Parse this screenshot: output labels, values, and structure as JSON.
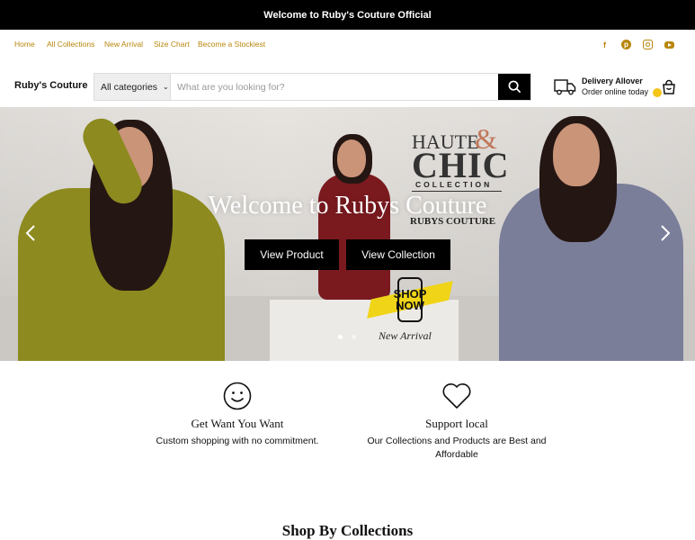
{
  "announcement": "Welcome to Ruby's Couture Official",
  "nav": {
    "items": [
      "Home",
      "All Collections",
      "New Arrival",
      "Size Chart",
      "Become a Stockiest"
    ]
  },
  "social": [
    "facebook-icon",
    "pinterest-icon",
    "instagram-icon",
    "youtube-icon"
  ],
  "header": {
    "brand": "Ruby's Couture",
    "category_select": "All categories",
    "search_placeholder": "What are you looking for?",
    "delivery_title": "Delivery Allover",
    "delivery_subtitle": "Order online today"
  },
  "hero": {
    "title": "Welcome to Rubys Couture",
    "buttons": [
      "View Product",
      "View Collection"
    ],
    "brand_haute": "HAUTE",
    "brand_amp": "&",
    "brand_chic": "CHIC",
    "brand_collection": "COLLECTION",
    "brand_rubys": "RUBYS COUTURE",
    "shop_now": "SHOP NOW",
    "new_arrival": "New Arrival",
    "slide_index": 1,
    "slide_count": 2
  },
  "features": [
    {
      "icon": "smile-icon",
      "title": "Get Want You Want",
      "description": "Custom shopping with no commitment."
    },
    {
      "icon": "heart-icon",
      "title": "Support local",
      "description": "Our Collections and Products are Best and Affordable"
    }
  ],
  "section_heading": "Shop By Collections",
  "colors": {
    "accent": "#b8860b",
    "announcement_bg": "#000000",
    "button_bg": "#000000"
  }
}
